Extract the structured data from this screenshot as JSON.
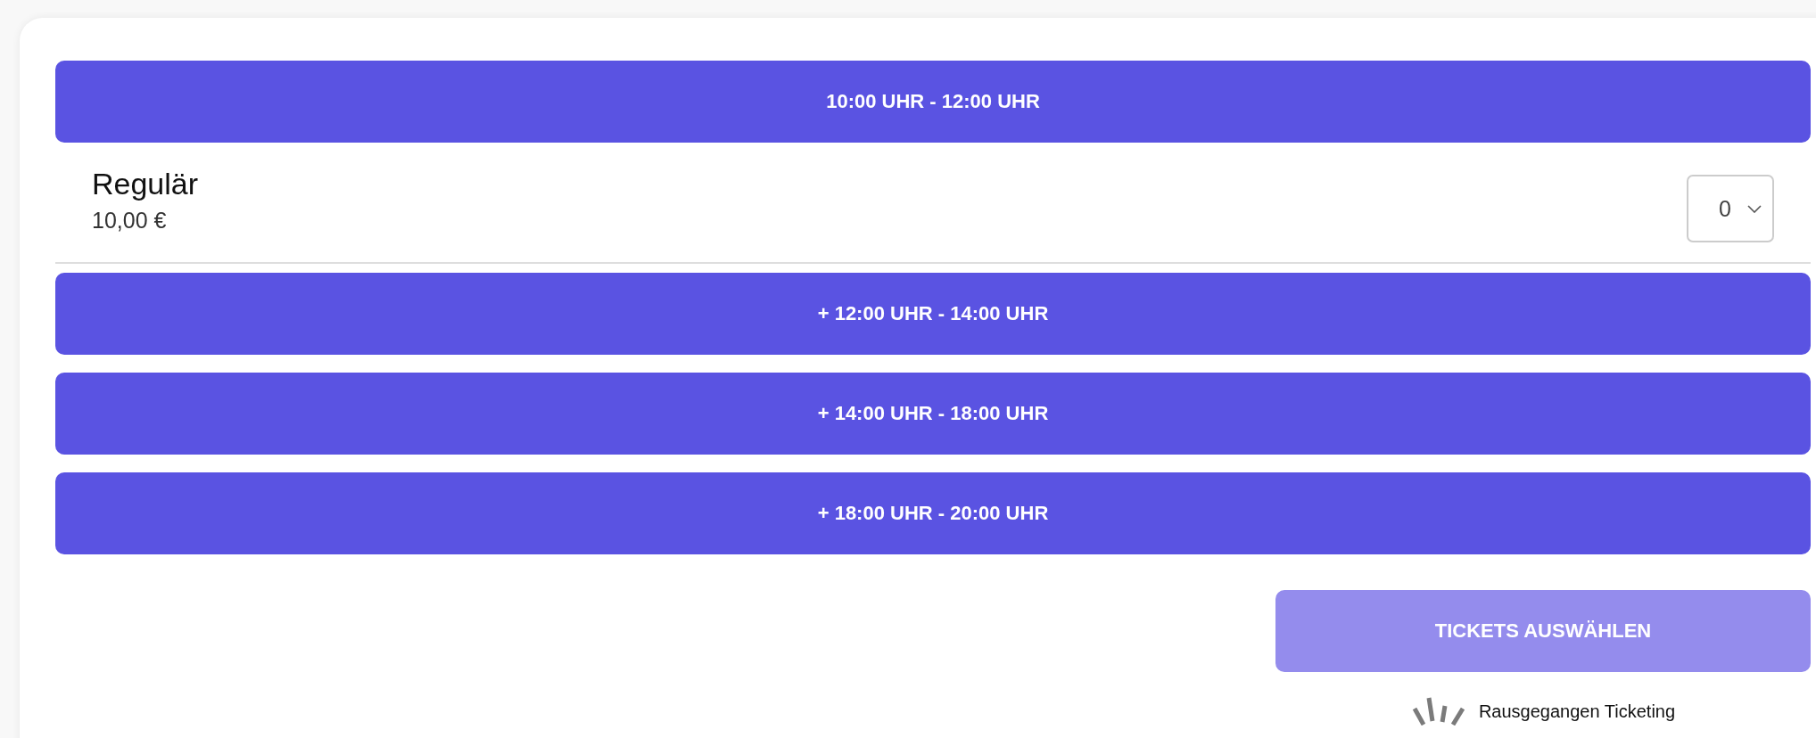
{
  "time_slots": [
    {
      "label": "10:00 UHR - 12:00 UHR",
      "expanded": true,
      "tickets": [
        {
          "name": "Regulär",
          "price": "10,00 €",
          "quantity": "0"
        }
      ]
    },
    {
      "label": "+ 12:00 UHR - 14:00 UHR",
      "expanded": false
    },
    {
      "label": "+ 14:00 UHR - 18:00 UHR",
      "expanded": false
    },
    {
      "label": "+ 18:00 UHR - 20:00 UHR",
      "expanded": false
    }
  ],
  "submit_button": {
    "label": "TICKETS AUSWÄHLEN",
    "disabled": true
  },
  "footer": {
    "brand": "Rausgegangen Ticketing"
  }
}
